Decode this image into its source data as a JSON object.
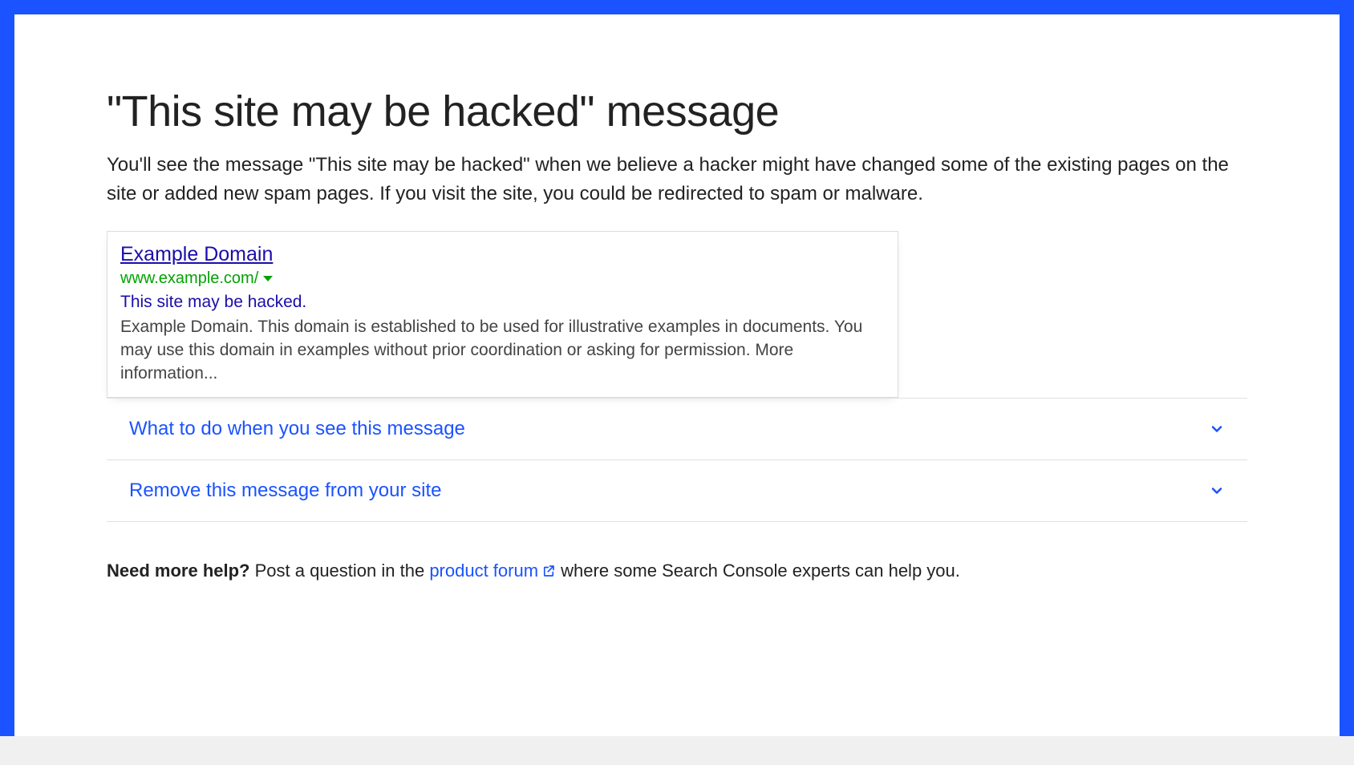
{
  "page": {
    "title": "\"This site may be hacked\" message",
    "intro": "You'll see the message \"This site may be hacked\" when we believe a hacker might have changed some of the existing pages on the site or added new spam pages. If you visit the site, you could be redirected to spam or malware."
  },
  "searchResult": {
    "title": "Example Domain",
    "url": "www.example.com/",
    "warning": "This site may be hacked.",
    "description": "Example Domain. This domain is established to be used for illustrative examples in documents. You may use this domain in examples without prior coordination or asking for permission. More information..."
  },
  "accordions": [
    {
      "title": "What to do when you see this message"
    },
    {
      "title": "Remove this message from your site"
    }
  ],
  "help": {
    "bold": "Need more help?",
    "prefix": " Post a question in the ",
    "linkText": "product forum",
    "suffix": "  where some Search Console experts can help you."
  },
  "colors": {
    "frame": "#1a53ff",
    "link": "#1a0dab",
    "accent": "#1a53ff",
    "urlGreen": "#00a300"
  }
}
